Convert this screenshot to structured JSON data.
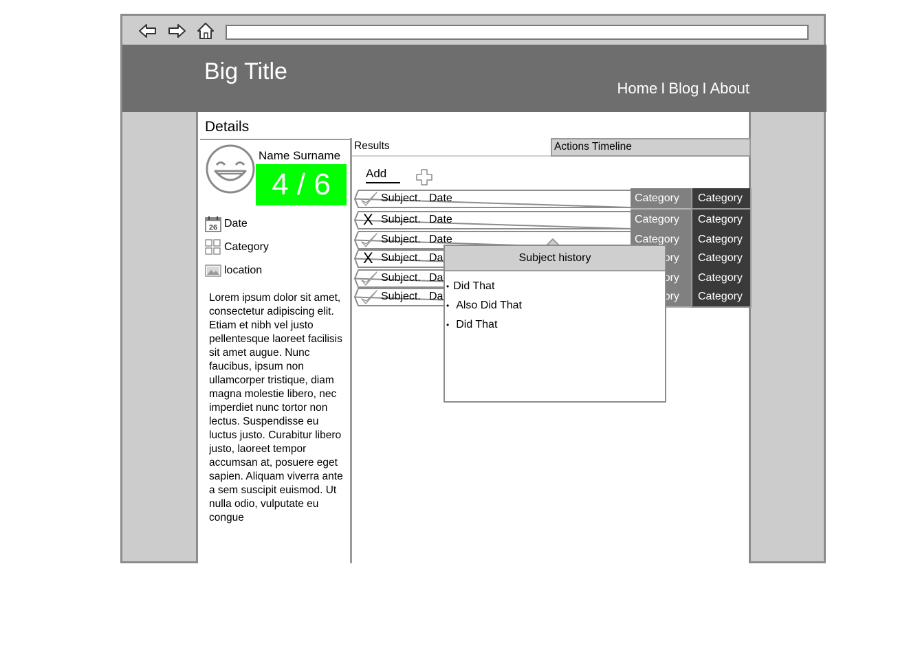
{
  "header": {
    "title": "Big Title",
    "nav": [
      "Home",
      "Blog",
      "About"
    ],
    "separator": "I",
    "bg_color": "#6e6e6e"
  },
  "browser": {
    "url": ""
  },
  "details": {
    "title": "Details",
    "name": "Name Surname",
    "score": "4 / 6",
    "score_color": "#00ff00",
    "date_label": "Date",
    "date_icon_day": "26",
    "category_label": "Category",
    "location_label": "location",
    "description": "Lorem ipsum dolor sit amet, consectetur adipiscing elit. Etiam et nibh vel justo pellentesque laoreet facilisis sit amet augue. Nunc faucibus, ipsum non ullamcorper tristique, diam magna molestie libero, nec imperdiet nunc tortor non lectus. Suspendisse eu luctus justo. Curabitur libero justo, laoreet tempor accumsan at, posuere eget sapien. Aliquam viverra ante a sem suscipit euismod. Ut nulla odio, vulputate eu congue"
  },
  "tabs": {
    "results": "Results",
    "actions_timeline": "Actions Timeline"
  },
  "results": {
    "add_label": "Add",
    "rows": [
      {
        "status": "check",
        "subject": "Subject.",
        "date": "Date",
        "category1": "Category",
        "category2": "Category"
      },
      {
        "status": "x",
        "subject": "Subject.",
        "date": "Date",
        "category1": "Category",
        "category2": "Category"
      },
      {
        "status": "check",
        "subject": "Subject.",
        "date": "Date",
        "category1": "Category",
        "category2": "Category"
      },
      {
        "status": "x",
        "subject": "Subject.",
        "date": "Date",
        "category1": "Category",
        "category2": "Category"
      },
      {
        "status": "check",
        "subject": "Subject.",
        "date": "Date",
        "category1": "Category",
        "category2": "Category"
      },
      {
        "status": "check",
        "subject": "Subject.",
        "date": "Date",
        "category1": "Category",
        "category2": "Category"
      }
    ],
    "x_glyph": "X"
  },
  "popup": {
    "title": "Subject history",
    "bullet": "•",
    "items": [
      "Did That",
      "Also Did That",
      "Did That"
    ]
  }
}
